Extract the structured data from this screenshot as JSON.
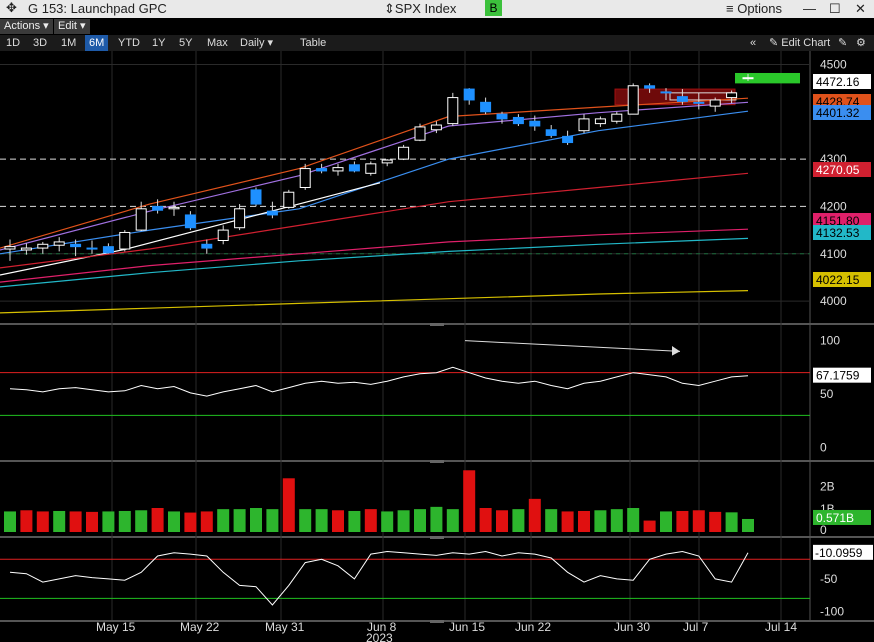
{
  "window": {
    "title": "G 153: Launchpad GPC",
    "ticker": "SPX Index",
    "badge": "B",
    "options_label": "Options",
    "min_icon": "minimize-icon",
    "max_icon": "maximize-icon",
    "close_icon": "close-icon"
  },
  "menu": {
    "actions": "Actions",
    "edit": "Edit"
  },
  "toolbar": {
    "ranges": [
      "1D",
      "3D",
      "1M",
      "6M",
      "YTD",
      "1Y",
      "5Y",
      "Max"
    ],
    "active_range": "6M",
    "interval": "Daily",
    "table": "Table",
    "edit_chart": "Edit Chart"
  },
  "colors": {
    "up": "#ffffff",
    "down": "#1e90ff",
    "rsi_line": "#ffffff",
    "vol_up": "#2db52d",
    "vol_down": "#e01010",
    "ma_orange": "#e0521b",
    "ma_purple": "#a070e0",
    "ma_blue": "#3a8ef0",
    "ma_white": "#ffffff",
    "ma_red": "#d02030",
    "ma_pink": "#e0206a",
    "ma_cyan": "#22b8c8",
    "ma_yellow": "#d6c000"
  },
  "chart_data": [
    {
      "type": "candlestick",
      "panel": "price",
      "y_ticks": [
        4000,
        4100,
        4200,
        4300,
        4500
      ],
      "ylim": [
        3960,
        4520
      ],
      "x_labels": [
        "May 15",
        "May 22",
        "May 31",
        "Jun 8",
        "Jun 15",
        "Jun 22",
        "Jun 30",
        "Jul 7",
        "Jul 14"
      ],
      "year_label": "2023",
      "candles": [
        {
          "o": 4110,
          "h": 4130,
          "l": 4085,
          "c": 4115
        },
        {
          "o": 4108,
          "h": 4122,
          "l": 4098,
          "c": 4112
        },
        {
          "o": 4112,
          "h": 4125,
          "l": 4100,
          "c": 4120
        },
        {
          "o": 4118,
          "h": 4135,
          "l": 4105,
          "c": 4125
        },
        {
          "o": 4120,
          "h": 4130,
          "l": 4095,
          "c": 4115
        },
        {
          "o": 4112,
          "h": 4128,
          "l": 4100,
          "c": 4110
        },
        {
          "o": 4115,
          "h": 4122,
          "l": 4100,
          "c": 4102
        },
        {
          "o": 4110,
          "h": 4150,
          "l": 4105,
          "c": 4145
        },
        {
          "o": 4150,
          "h": 4210,
          "l": 4148,
          "c": 4195
        },
        {
          "o": 4200,
          "h": 4215,
          "l": 4185,
          "c": 4192
        },
        {
          "o": 4195,
          "h": 4210,
          "l": 4180,
          "c": 4198
        },
        {
          "o": 4182,
          "h": 4190,
          "l": 4150,
          "c": 4155
        },
        {
          "o": 4120,
          "h": 4130,
          "l": 4100,
          "c": 4112
        },
        {
          "o": 4128,
          "h": 4160,
          "l": 4120,
          "c": 4150
        },
        {
          "o": 4155,
          "h": 4205,
          "l": 4150,
          "c": 4195
        },
        {
          "o": 4235,
          "h": 4240,
          "l": 4200,
          "c": 4205
        },
        {
          "o": 4190,
          "h": 4210,
          "l": 4175,
          "c": 4182
        },
        {
          "o": 4198,
          "h": 4235,
          "l": 4195,
          "c": 4230
        },
        {
          "o": 4240,
          "h": 4290,
          "l": 4235,
          "c": 4280
        },
        {
          "o": 4280,
          "h": 4290,
          "l": 4270,
          "c": 4275
        },
        {
          "o": 4275,
          "h": 4290,
          "l": 4265,
          "c": 4282
        },
        {
          "o": 4288,
          "h": 4295,
          "l": 4272,
          "c": 4275
        },
        {
          "o": 4270,
          "h": 4295,
          "l": 4265,
          "c": 4290
        },
        {
          "o": 4292,
          "h": 4300,
          "l": 4285,
          "c": 4298
        },
        {
          "o": 4300,
          "h": 4330,
          "l": 4298,
          "c": 4325
        },
        {
          "o": 4340,
          "h": 4375,
          "l": 4338,
          "c": 4368
        },
        {
          "o": 4362,
          "h": 4380,
          "l": 4355,
          "c": 4372
        },
        {
          "o": 4375,
          "h": 4440,
          "l": 4370,
          "c": 4430
        },
        {
          "o": 4448,
          "h": 4450,
          "l": 4415,
          "c": 4425
        },
        {
          "o": 4420,
          "h": 4430,
          "l": 4395,
          "c": 4400
        },
        {
          "o": 4395,
          "h": 4400,
          "l": 4375,
          "c": 4385
        },
        {
          "o": 4388,
          "h": 4395,
          "l": 4370,
          "c": 4375
        },
        {
          "o": 4380,
          "h": 4392,
          "l": 4360,
          "c": 4370
        },
        {
          "o": 4362,
          "h": 4372,
          "l": 4345,
          "c": 4350
        },
        {
          "o": 4348,
          "h": 4360,
          "l": 4330,
          "c": 4335
        },
        {
          "o": 4360,
          "h": 4395,
          "l": 4355,
          "c": 4385
        },
        {
          "o": 4375,
          "h": 4390,
          "l": 4368,
          "c": 4385
        },
        {
          "o": 4380,
          "h": 4400,
          "l": 4375,
          "c": 4395
        },
        {
          "o": 4395,
          "h": 4460,
          "l": 4395,
          "c": 4455
        },
        {
          "o": 4455,
          "h": 4460,
          "l": 4440,
          "c": 4450
        },
        {
          "o": 4442,
          "h": 4450,
          "l": 4425,
          "c": 4440
        },
        {
          "o": 4432,
          "h": 4448,
          "l": 4415,
          "c": 4422
        },
        {
          "o": 4420,
          "h": 4440,
          "l": 4405,
          "c": 4418
        },
        {
          "o": 4412,
          "h": 4430,
          "l": 4400,
          "c": 4425
        },
        {
          "o": 4430,
          "h": 4445,
          "l": 4418,
          "c": 4440
        },
        {
          "o": 4470,
          "h": 4480,
          "l": 4465,
          "c": 4472
        }
      ],
      "moving_averages": [
        {
          "color_key": "ma_orange",
          "values": [
            4112,
            4205,
            4280,
            4390,
            4410,
            4428.74
          ]
        },
        {
          "color_key": "ma_purple",
          "values": [
            4108,
            4190,
            4265,
            4370,
            4398,
            4420
          ]
        },
        {
          "color_key": "ma_blue",
          "values": [
            4100,
            4150,
            4195,
            4300,
            4360,
            4401.32
          ]
        },
        {
          "color_key": "ma_white",
          "values": [
            4055,
            4110,
            4180,
            4250
          ]
        },
        {
          "color_key": "ma_red",
          "values": [
            4070,
            4110,
            4160,
            4210,
            4240,
            4270.05
          ]
        },
        {
          "color_key": "ma_pink",
          "values": [
            4040,
            4075,
            4100,
            4125,
            4140,
            4151.8
          ]
        },
        {
          "color_key": "ma_cyan",
          "values": [
            4030,
            4060,
            4085,
            4105,
            4120,
            4132.53
          ]
        },
        {
          "color_key": "ma_yellow",
          "values": [
            3975,
            3985,
            3995,
            4005,
            4015,
            4022.15
          ]
        }
      ],
      "last_values": [
        {
          "label": "4472.16",
          "color": "#ffffff",
          "text": "#000000"
        },
        {
          "label": "4428.74",
          "color": "#e0521b",
          "text": "#000000"
        },
        {
          "label": "4401.32",
          "color": "#3a8ef0",
          "text": "#000000"
        },
        {
          "label": "4270.05",
          "color": "#d02030",
          "text": "#ffffff"
        },
        {
          "label": "4151.80",
          "color": "#e0206a",
          "text": "#000000"
        },
        {
          "label": "4132.53",
          "color": "#22b8c8",
          "text": "#000000"
        },
        {
          "label": "4022.15",
          "color": "#d6c000",
          "text": "#000000"
        }
      ]
    },
    {
      "type": "line",
      "panel": "rsi",
      "y_ticks": [
        0,
        50,
        100
      ],
      "ylim": [
        -10,
        110
      ],
      "upper": 70,
      "lower": 30,
      "last_label": "67.1759",
      "values": [
        55,
        54,
        52,
        55,
        56,
        54,
        52,
        53,
        58,
        55,
        57,
        51,
        48,
        52,
        55,
        58,
        52,
        56,
        60,
        62,
        60,
        61,
        59,
        62,
        66,
        69,
        70,
        75,
        70,
        65,
        62,
        60,
        62,
        58,
        55,
        60,
        62,
        66,
        70,
        68,
        66,
        60,
        58,
        62,
        66,
        67.18
      ]
    },
    {
      "type": "bar",
      "panel": "volume",
      "y_ticks": [
        "2B",
        "1B",
        "0"
      ],
      "last_label": "0.571B",
      "values": [
        0.9,
        0.95,
        0.9,
        0.92,
        0.9,
        0.88,
        0.9,
        0.92,
        0.95,
        1.05,
        0.9,
        0.85,
        0.9,
        1.0,
        1.0,
        1.05,
        1.0,
        2.35,
        1.0,
        1.0,
        0.95,
        0.92,
        1.0,
        0.9,
        0.95,
        1.0,
        1.1,
        1.0,
        2.7,
        1.05,
        0.95,
        1.0,
        1.45,
        1.0,
        0.9,
        0.92,
        0.95,
        1.0,
        1.05,
        0.5,
        0.9,
        0.92,
        0.95,
        0.88,
        0.86,
        0.57
      ],
      "up": [
        1,
        0,
        0,
        1,
        0,
        0,
        1,
        1,
        1,
        0,
        1,
        0,
        0,
        1,
        1,
        1,
        1,
        0,
        1,
        1,
        0,
        1,
        0,
        1,
        1,
        1,
        1,
        1,
        0,
        0,
        0,
        1,
        0,
        1,
        0,
        0,
        1,
        1,
        1,
        0,
        1,
        0,
        0,
        0,
        1,
        1
      ]
    },
    {
      "type": "line",
      "panel": "oscillator",
      "y_ticks": [
        "-10.0959",
        "-50",
        "-100"
      ],
      "ylim": [
        -110,
        5
      ],
      "upper": -20,
      "lower": -80,
      "last_label": "-10.0959",
      "values": [
        -40,
        -42,
        -55,
        -50,
        -45,
        -48,
        -50,
        -52,
        -40,
        -15,
        -10,
        -12,
        -15,
        -40,
        -60,
        -62,
        -90,
        -60,
        -25,
        -20,
        -30,
        -50,
        -12,
        -8,
        -10,
        -12,
        -14,
        -10,
        -12,
        -8,
        -15,
        -10,
        -12,
        -18,
        -40,
        -55,
        -45,
        -50,
        -52,
        -20,
        -12,
        -8,
        -15,
        -50,
        -55,
        -10.1
      ]
    }
  ]
}
